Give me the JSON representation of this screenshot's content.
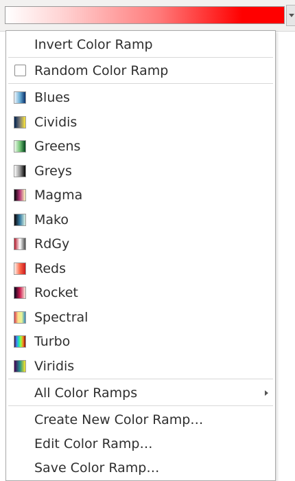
{
  "menu": {
    "invert_label": "Invert Color Ramp",
    "random_label": "Random Color Ramp",
    "random_checked": false,
    "ramps": [
      {
        "label": "Blues",
        "icon": "blues-gradient-swatch"
      },
      {
        "label": "Cividis",
        "icon": "cividis-gradient-swatch"
      },
      {
        "label": "Greens",
        "icon": "greens-gradient-swatch"
      },
      {
        "label": "Greys",
        "icon": "greys-gradient-swatch"
      },
      {
        "label": "Magma",
        "icon": "magma-gradient-swatch"
      },
      {
        "label": "Mako",
        "icon": "mako-gradient-swatch"
      },
      {
        "label": "RdGy",
        "icon": "rdgy-gradient-swatch"
      },
      {
        "label": "Reds",
        "icon": "reds-gradient-swatch"
      },
      {
        "label": "Rocket",
        "icon": "rocket-gradient-swatch"
      },
      {
        "label": "Spectral",
        "icon": "spectral-gradient-swatch"
      },
      {
        "label": "Turbo",
        "icon": "turbo-gradient-swatch"
      },
      {
        "label": "Viridis",
        "icon": "viridis-gradient-swatch"
      }
    ],
    "all_ramps_label": "All Color Ramps",
    "create_label": "Create New Color Ramp…",
    "edit_label": "Edit Color Ramp…",
    "save_label": "Save Color Ramp…"
  },
  "colors": {
    "current_ramp_start": "#ffffff",
    "current_ramp_end": "#ff0000"
  }
}
